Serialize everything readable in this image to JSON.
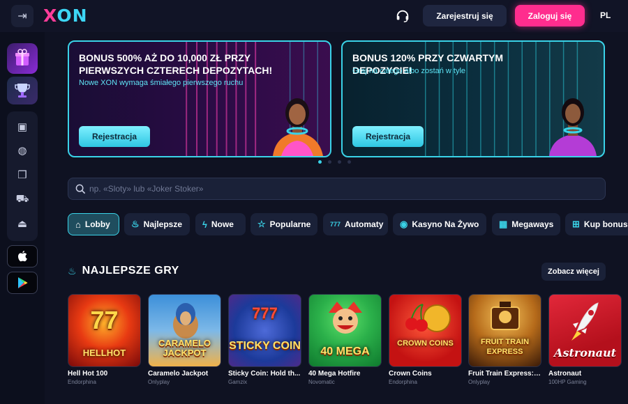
{
  "header": {
    "brand": {
      "x": "X",
      "on": "ON"
    },
    "register_label": "Zarejestruj się",
    "login_label": "Zaloguj się",
    "language": "PL"
  },
  "sidebar": {
    "icons": [
      "gift-box-icon",
      "trophy-icon",
      "slot-machine-icon",
      "basketball-icon",
      "gift-icon",
      "cart-icon",
      "podium-icon"
    ],
    "stores": [
      "apple-icon",
      "google-play-icon"
    ]
  },
  "banners": [
    {
      "title": "BONUS 500% AŻ DO 10,000 ZŁ PRZY PIERWSZYCH CZTERECH DEPOZYTACH!",
      "subtitle": "Nowe XON wymaga śmiałego pierwszego ruchu",
      "button": "Rejestracja"
    },
    {
      "title": "BONUS 120% PRZY CZWARTYM DEPOZYCIE!",
      "subtitle": "Graj na całego albo zostań w tyle",
      "button": "Rejestracja"
    }
  ],
  "carousel": {
    "active_index": 0,
    "count": 4
  },
  "search": {
    "placeholder": "np. «Sloty» lub «Joker Stoker»"
  },
  "tabs": [
    {
      "label": "Lobby",
      "icon": "home-icon",
      "active": true
    },
    {
      "label": "Najlepsze",
      "icon": "flame-icon",
      "active": false
    },
    {
      "label": "Nowe",
      "icon": "lightning-icon",
      "active": false
    },
    {
      "label": "Popularne",
      "icon": "star-icon",
      "active": false
    },
    {
      "label": "Automaty",
      "icon": "slot-777-icon",
      "active": false
    },
    {
      "label": "Kasyno Na Żywo",
      "icon": "live-chip-icon",
      "active": false
    },
    {
      "label": "Megaways",
      "icon": "megaways-icon",
      "active": false
    },
    {
      "label": "Kup bonus",
      "icon": "bonus-icon",
      "active": false
    }
  ],
  "section": {
    "title": "NAJLEPSZE GRY",
    "see_more": "Zobacz więcej"
  },
  "games": [
    {
      "name": "Hell Hot 100",
      "provider": "Endorphina",
      "art": "HELLHOT",
      "colors": [
        "#7a0a0a",
        "#e83a12"
      ]
    },
    {
      "name": "Caramelo Jackpot",
      "provider": "Onlyplay",
      "art": "CARAMELO JACKPOT",
      "colors": [
        "#3c8fd9",
        "#f0b24a"
      ]
    },
    {
      "name": "Sticky Coin: Hold th...",
      "provider": "Gamzix",
      "art": "STICKY COIN",
      "colors": [
        "#1c3a9a",
        "#4d2a8a"
      ]
    },
    {
      "name": "40 Mega Hotfire",
      "provider": "Novomatic",
      "art": "40 MEGA",
      "colors": [
        "#0f7a2e",
        "#2bb04a"
      ]
    },
    {
      "name": "Crown Coins",
      "provider": "Endorphina",
      "art": "CROWN COINS",
      "colors": [
        "#c41212",
        "#ff3a2a"
      ]
    },
    {
      "name": "Fruit Train Express: ...",
      "provider": "Onlyplay",
      "art": "FRUIT TRAIN EXPRESS",
      "colors": [
        "#3a1a08",
        "#b56a1a"
      ]
    },
    {
      "name": "Astronaut",
      "provider": "100HP Gaming",
      "art": "Astronaut",
      "colors": [
        "#b4101c",
        "#e2283a"
      ]
    }
  ]
}
